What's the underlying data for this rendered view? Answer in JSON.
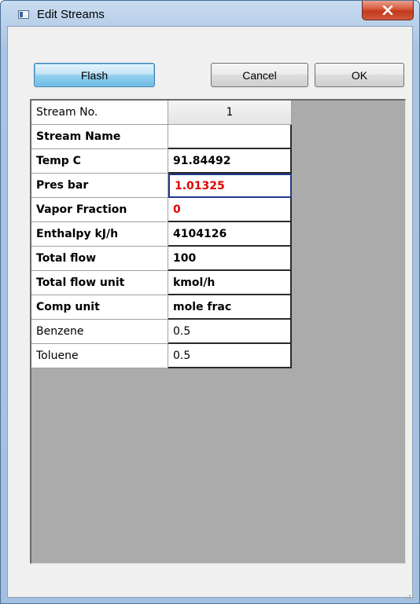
{
  "window": {
    "title": "Edit Streams",
    "close_icon": "close-icon"
  },
  "toolbar": {
    "flash_label": "Flash",
    "cancel_label": "Cancel",
    "ok_label": "OK"
  },
  "grid": {
    "rows": [
      {
        "label": "Stream No.",
        "value": "1"
      },
      {
        "label": "Stream Name",
        "value": ""
      },
      {
        "label": "Temp  C",
        "value": "91.84492"
      },
      {
        "label": "Pres  bar",
        "value": "1.01325"
      },
      {
        "label": "Vapor Fraction",
        "value": "0"
      },
      {
        "label": "Enthalpy kJ/h",
        "value": "4104126"
      },
      {
        "label": "Total flow",
        "value": "100"
      },
      {
        "label": "Total flow unit",
        "value": "kmol/h"
      },
      {
        "label": "Comp unit",
        "value": "mole frac"
      },
      {
        "label": "Benzene",
        "value": "0.5"
      },
      {
        "label": "Toluene",
        "value": "0.5"
      }
    ]
  },
  "colors": {
    "highlight_value": "#e00000",
    "selection_border": "#1d3a8c",
    "grid_background": "#ababab"
  }
}
